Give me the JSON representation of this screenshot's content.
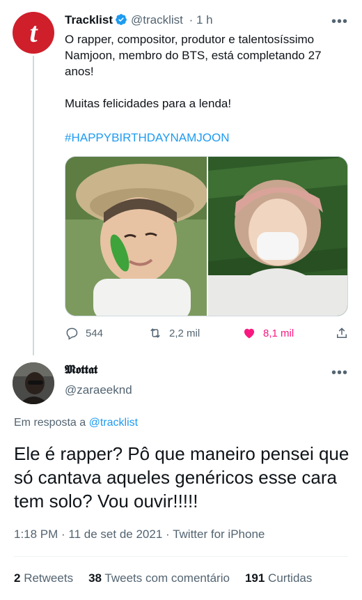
{
  "parent_tweet": {
    "display_name": "Tracklist",
    "handle": "@tracklist",
    "time": "· 1 h",
    "more": "•••",
    "avatar_letter": "t",
    "text": "O rapper, compositor, produtor e talentosíssimo\nNamjoon, membro do BTS, está completando 27\nanos!\n\nMuitas felicidades para a lenda!",
    "hashtag": "#HAPPYBIRTHDAYNAMJOON",
    "actions": {
      "reply_count": "544",
      "retweet_count": "2,2 mil",
      "like_count": "8,1 mil"
    },
    "like_color": "#f91880"
  },
  "reply_tweet": {
    "display_name": "𝕸𝖔𝖙𝖙𝖆𝖙",
    "handle": "@zaraeeknd",
    "more": "•••",
    "reply_prefix": "Em resposta a",
    "reply_target": "@tracklist",
    "text": "Ele é rapper? Pô que maneiro pensei que só cantava aqueles genéricos esse cara tem solo? Vou ouvir!!!!!",
    "meta": "1:18 PM · 11 de set de 2021 · Twitter for iPhone",
    "stats": {
      "retweets_count": "2",
      "retweets_label": "Retweets",
      "quotes_count": "38",
      "quotes_label": "Tweets com comentário",
      "likes_count": "191",
      "likes_label": "Curtidas"
    }
  },
  "colors": {
    "link": "#1d9bf0",
    "muted": "#536471",
    "brand_red": "#cf1f2b"
  }
}
